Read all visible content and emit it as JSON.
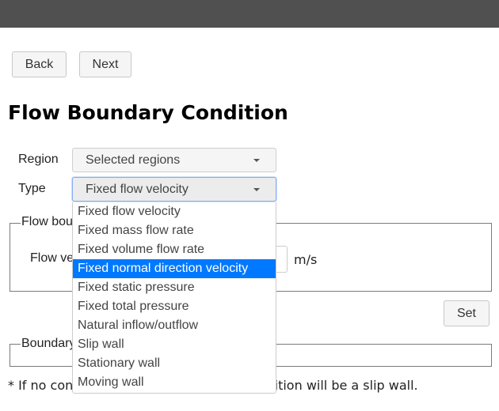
{
  "nav": {
    "back_label": "Back",
    "next_label": "Next"
  },
  "page": {
    "title": "Flow Boundary Condition"
  },
  "form": {
    "region_label": "Region",
    "region_value": "Selected regions",
    "type_label": "Type",
    "type_value": "Fixed flow velocity"
  },
  "dropdown": {
    "highlighted_index": 3,
    "options": [
      "Fixed flow velocity",
      "Fixed mass flow rate",
      "Fixed volume flow rate",
      "Fixed normal direction velocity",
      "Fixed static pressure",
      "Fixed total pressure",
      "Natural inflow/outflow",
      "Slip wall",
      "Stationary wall",
      "Moving wall"
    ]
  },
  "flow_box": {
    "legend": "Flow boundary condition",
    "velocity_label": "Flow velocity",
    "velocity_value": "",
    "unit": "m/s"
  },
  "set_label": "Set",
  "boundary_box": {
    "legend": "Boundary"
  },
  "note": "* If no condition is set, the boundary condition will be a slip wall.",
  "colors": {
    "highlight": "#0078ff",
    "topbar": "#505050"
  }
}
